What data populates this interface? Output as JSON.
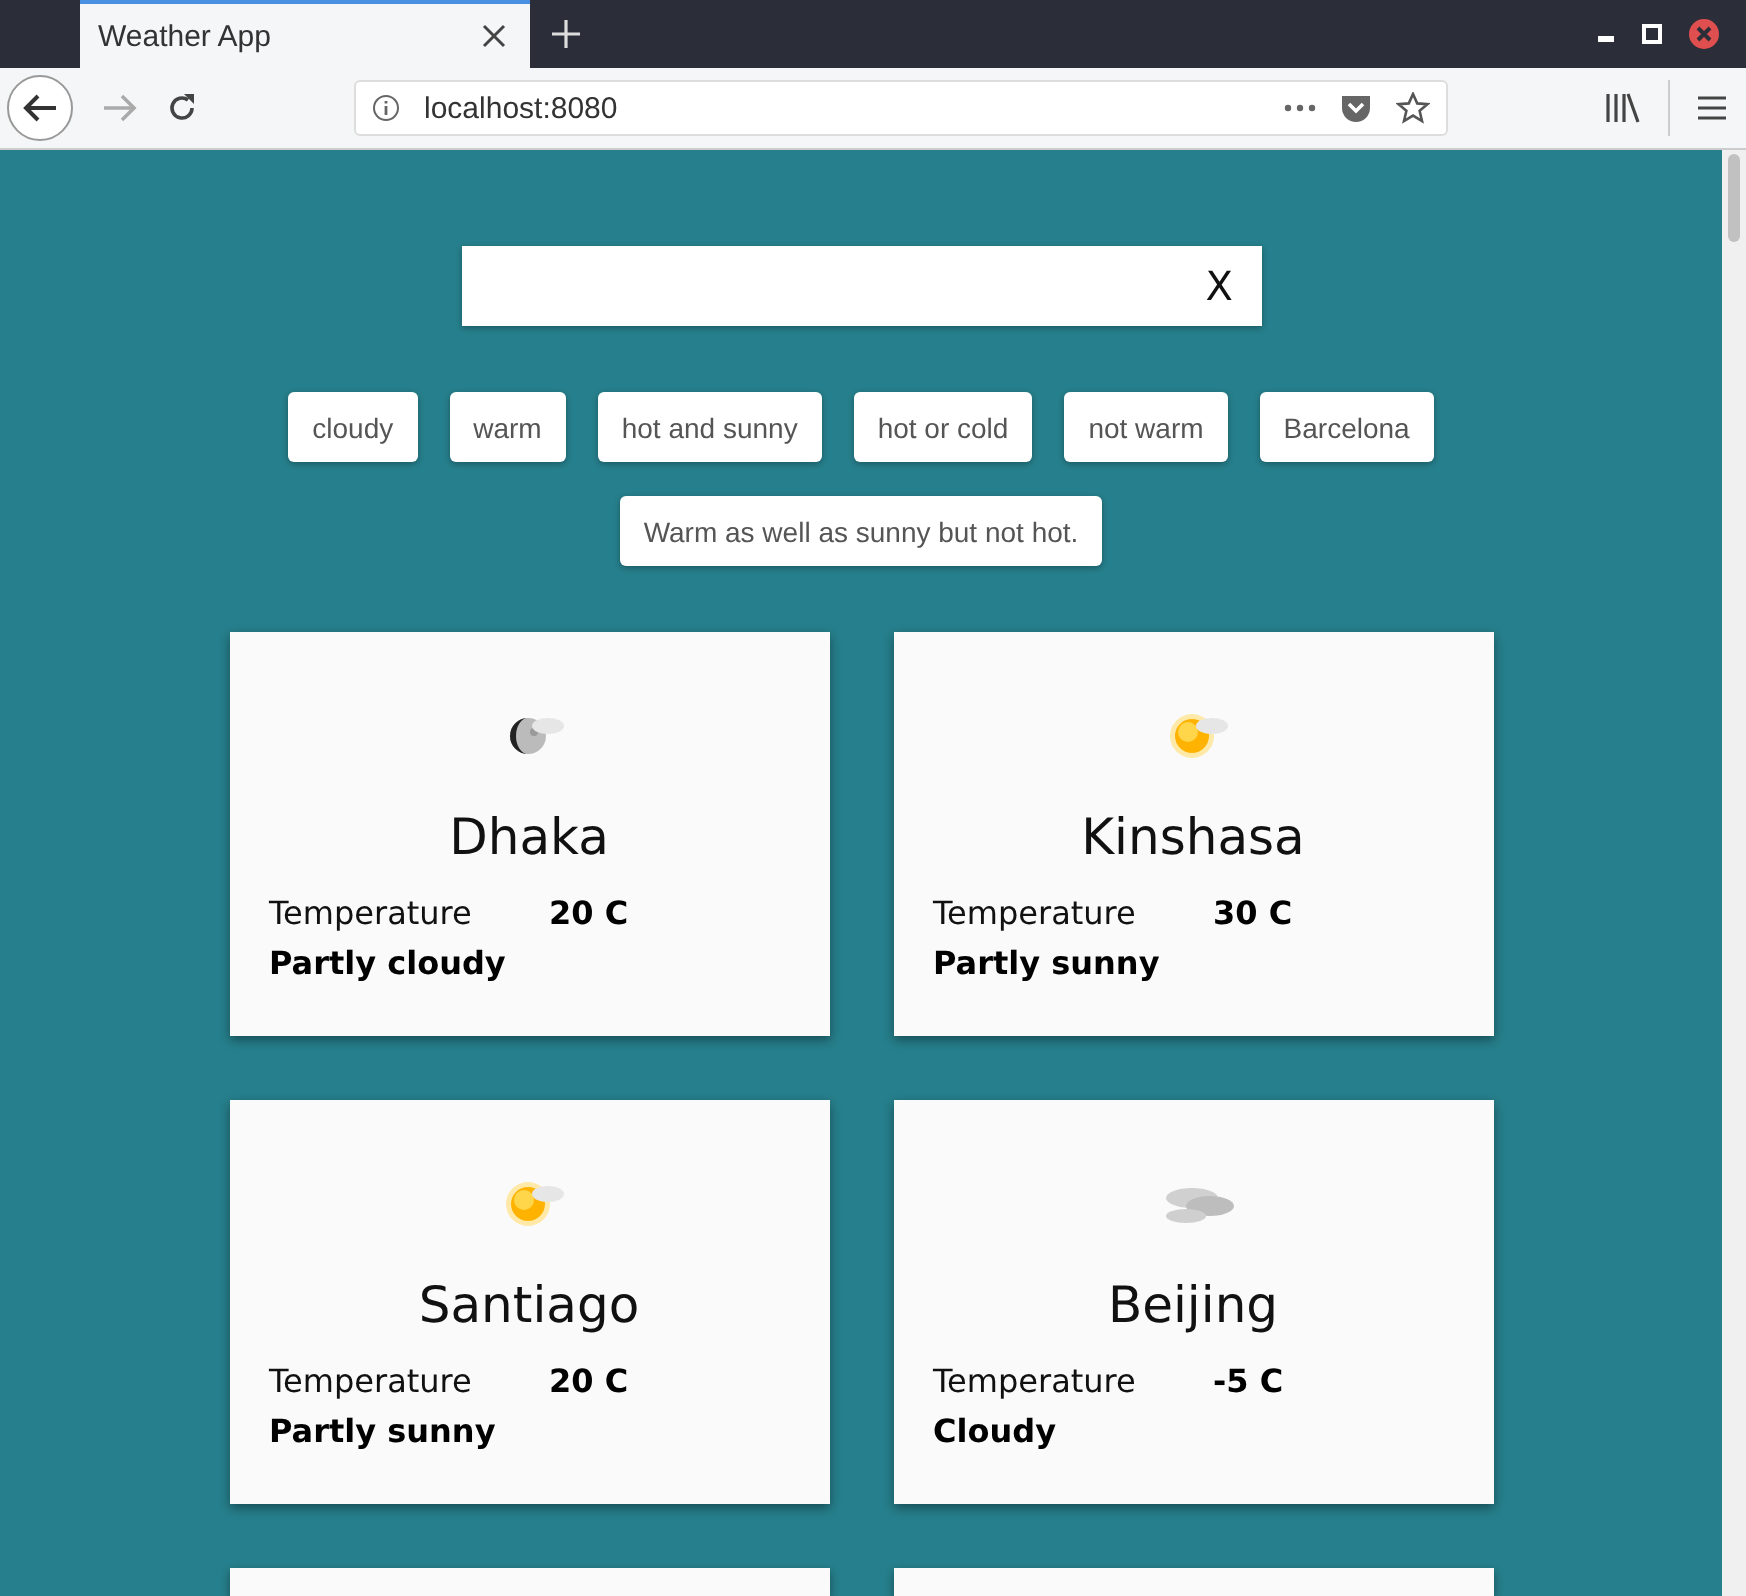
{
  "browser": {
    "tab_title": "Weather App",
    "url": "localhost:8080"
  },
  "search": {
    "clear_label": "X"
  },
  "suggestions": [
    "cloudy",
    "warm",
    "hot and sunny",
    "hot or cold",
    "not warm",
    "Barcelona",
    "Warm as well as sunny but not hot."
  ],
  "cards": [
    {
      "kind": "moon",
      "city": "Dhaka",
      "temperature_label": "Temperature",
      "temperature": "20 C",
      "condition": "Partly cloudy"
    },
    {
      "kind": "sun",
      "city": "Kinshasa",
      "temperature_label": "Temperature",
      "temperature": "30 C",
      "condition": "Partly sunny"
    },
    {
      "kind": "sun",
      "city": "Santiago",
      "temperature_label": "Temperature",
      "temperature": "20 C",
      "condition": "Partly sunny"
    },
    {
      "kind": "cloud",
      "city": "Beijing",
      "temperature_label": "Temperature",
      "temperature": "-5 C",
      "condition": "Cloudy"
    },
    {
      "kind": "cut"
    },
    {
      "kind": "cut"
    }
  ]
}
